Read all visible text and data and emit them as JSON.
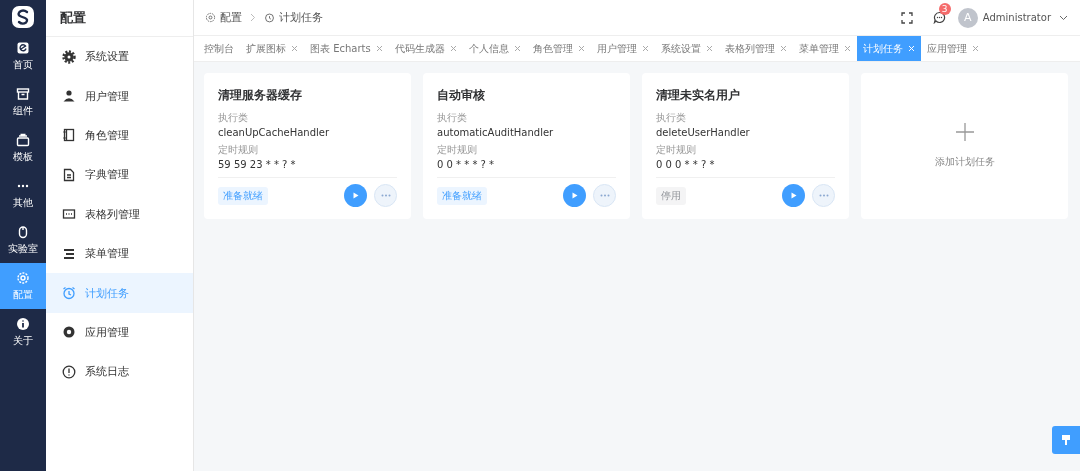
{
  "rail": {
    "items": [
      {
        "label": "首页",
        "selected": false
      },
      {
        "label": "组件",
        "selected": false
      },
      {
        "label": "模板",
        "selected": false
      },
      {
        "label": "其他",
        "selected": false
      },
      {
        "label": "实验室",
        "selected": false
      },
      {
        "label": "配置",
        "selected": true
      },
      {
        "label": "关于",
        "selected": false
      }
    ]
  },
  "sidebar": {
    "title": "配置",
    "items": [
      {
        "label": "系统设置",
        "selected": false
      },
      {
        "label": "用户管理",
        "selected": false
      },
      {
        "label": "角色管理",
        "selected": false
      },
      {
        "label": "字典管理",
        "selected": false
      },
      {
        "label": "表格列管理",
        "selected": false
      },
      {
        "label": "菜单管理",
        "selected": false
      },
      {
        "label": "计划任务",
        "selected": true
      },
      {
        "label": "应用管理",
        "selected": false
      },
      {
        "label": "系统日志",
        "selected": false
      }
    ]
  },
  "breadcrumb": [
    "配置",
    "计划任务"
  ],
  "header": {
    "badge": "3",
    "avatar": "A",
    "user": "Administrator"
  },
  "tabs": [
    {
      "label": "控制台",
      "closable": false,
      "selected": false
    },
    {
      "label": "扩展图标",
      "closable": true,
      "selected": false
    },
    {
      "label": "图表 Echarts",
      "closable": true,
      "selected": false
    },
    {
      "label": "代码生成器",
      "closable": true,
      "selected": false
    },
    {
      "label": "个人信息",
      "closable": true,
      "selected": false
    },
    {
      "label": "角色管理",
      "closable": true,
      "selected": false
    },
    {
      "label": "用户管理",
      "closable": true,
      "selected": false
    },
    {
      "label": "系统设置",
      "closable": true,
      "selected": false
    },
    {
      "label": "表格列管理",
      "closable": true,
      "selected": false
    },
    {
      "label": "菜单管理",
      "closable": true,
      "selected": false
    },
    {
      "label": "计划任务",
      "closable": true,
      "selected": true
    },
    {
      "label": "应用管理",
      "closable": true,
      "selected": false
    }
  ],
  "tasks": [
    {
      "title": "清理服务器缓存",
      "class_label": "执行类",
      "class_name": "cleanUpCacheHandler",
      "rule_label": "定时规则",
      "rule": "59 59 23 * * ? *",
      "status": {
        "label": "准备就绪",
        "kind": "ready"
      }
    },
    {
      "title": "自动审核",
      "class_label": "执行类",
      "class_name": "automaticAuditHandler",
      "rule_label": "定时规则",
      "rule": "0 0 * * * ? *",
      "status": {
        "label": "准备就绪",
        "kind": "ready"
      }
    },
    {
      "title": "清理未实名用户",
      "class_label": "执行类",
      "class_name": "deleteUserHandler",
      "rule_label": "定时规则",
      "rule": "0 0 0 * * ? *",
      "status": {
        "label": "停用",
        "kind": "stopped"
      }
    }
  ],
  "add_card": {
    "label": "添加计划任务"
  }
}
